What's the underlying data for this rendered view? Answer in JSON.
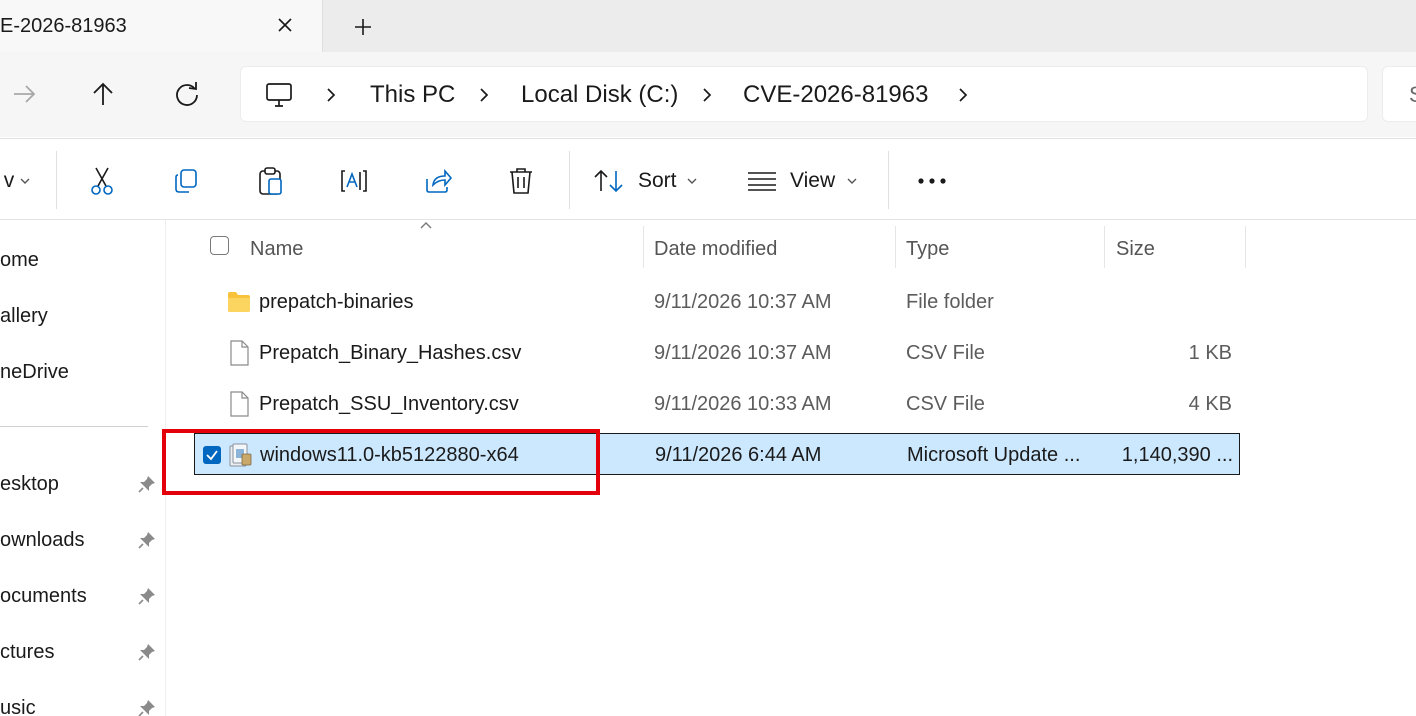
{
  "tab": {
    "title": "E-2026-81963",
    "close_glyph": "✕",
    "new_tab_glyph": "+"
  },
  "nav": {
    "forward": "→",
    "up": "↑",
    "refresh": "↻"
  },
  "address": {
    "crumbs": [
      "This PC",
      "Local Disk (C:)",
      "CVE-2026-81963"
    ],
    "search_fragment": "S"
  },
  "toolbar": {
    "new_fragment": "v",
    "sort_label": "Sort",
    "view_label": "View",
    "more_glyph": "•••"
  },
  "sidebar": {
    "items": [
      {
        "label": "ome",
        "pinned": false
      },
      {
        "label": "allery",
        "pinned": false
      },
      {
        "label": "neDrive",
        "pinned": false
      },
      {
        "label": "esktop",
        "pinned": true
      },
      {
        "label": "ownloads",
        "pinned": true
      },
      {
        "label": "ocuments",
        "pinned": true
      },
      {
        "label": "ctures",
        "pinned": true
      },
      {
        "label": "usic",
        "pinned": true
      }
    ]
  },
  "columns": {
    "name": "Name",
    "date": "Date modified",
    "type": "Type",
    "size": "Size"
  },
  "files": [
    {
      "name": "prepatch-binaries",
      "date": "9/11/2026 10:37 AM",
      "type": "File folder",
      "size": "",
      "icon": "folder-icon",
      "selected": false
    },
    {
      "name": "Prepatch_Binary_Hashes.csv",
      "date": "9/11/2026 10:37 AM",
      "type": "CSV File",
      "size": "1 KB",
      "icon": "file-icon",
      "selected": false
    },
    {
      "name": "Prepatch_SSU_Inventory.csv",
      "date": "9/11/2026 10:33 AM",
      "type": "CSV File",
      "size": "4 KB",
      "icon": "file-icon",
      "selected": false
    },
    {
      "name": "windows11.0-kb5122880-x64",
      "date": "9/11/2026 6:44 AM",
      "type": "Microsoft Update ...",
      "size": "1,140,390 ...",
      "icon": "msu-package-icon",
      "selected": true
    }
  ],
  "colors": {
    "selection": "#cce8ff",
    "highlight_box": "#e3000b",
    "accent": "#0067c0",
    "folder": "#f8c33a"
  }
}
